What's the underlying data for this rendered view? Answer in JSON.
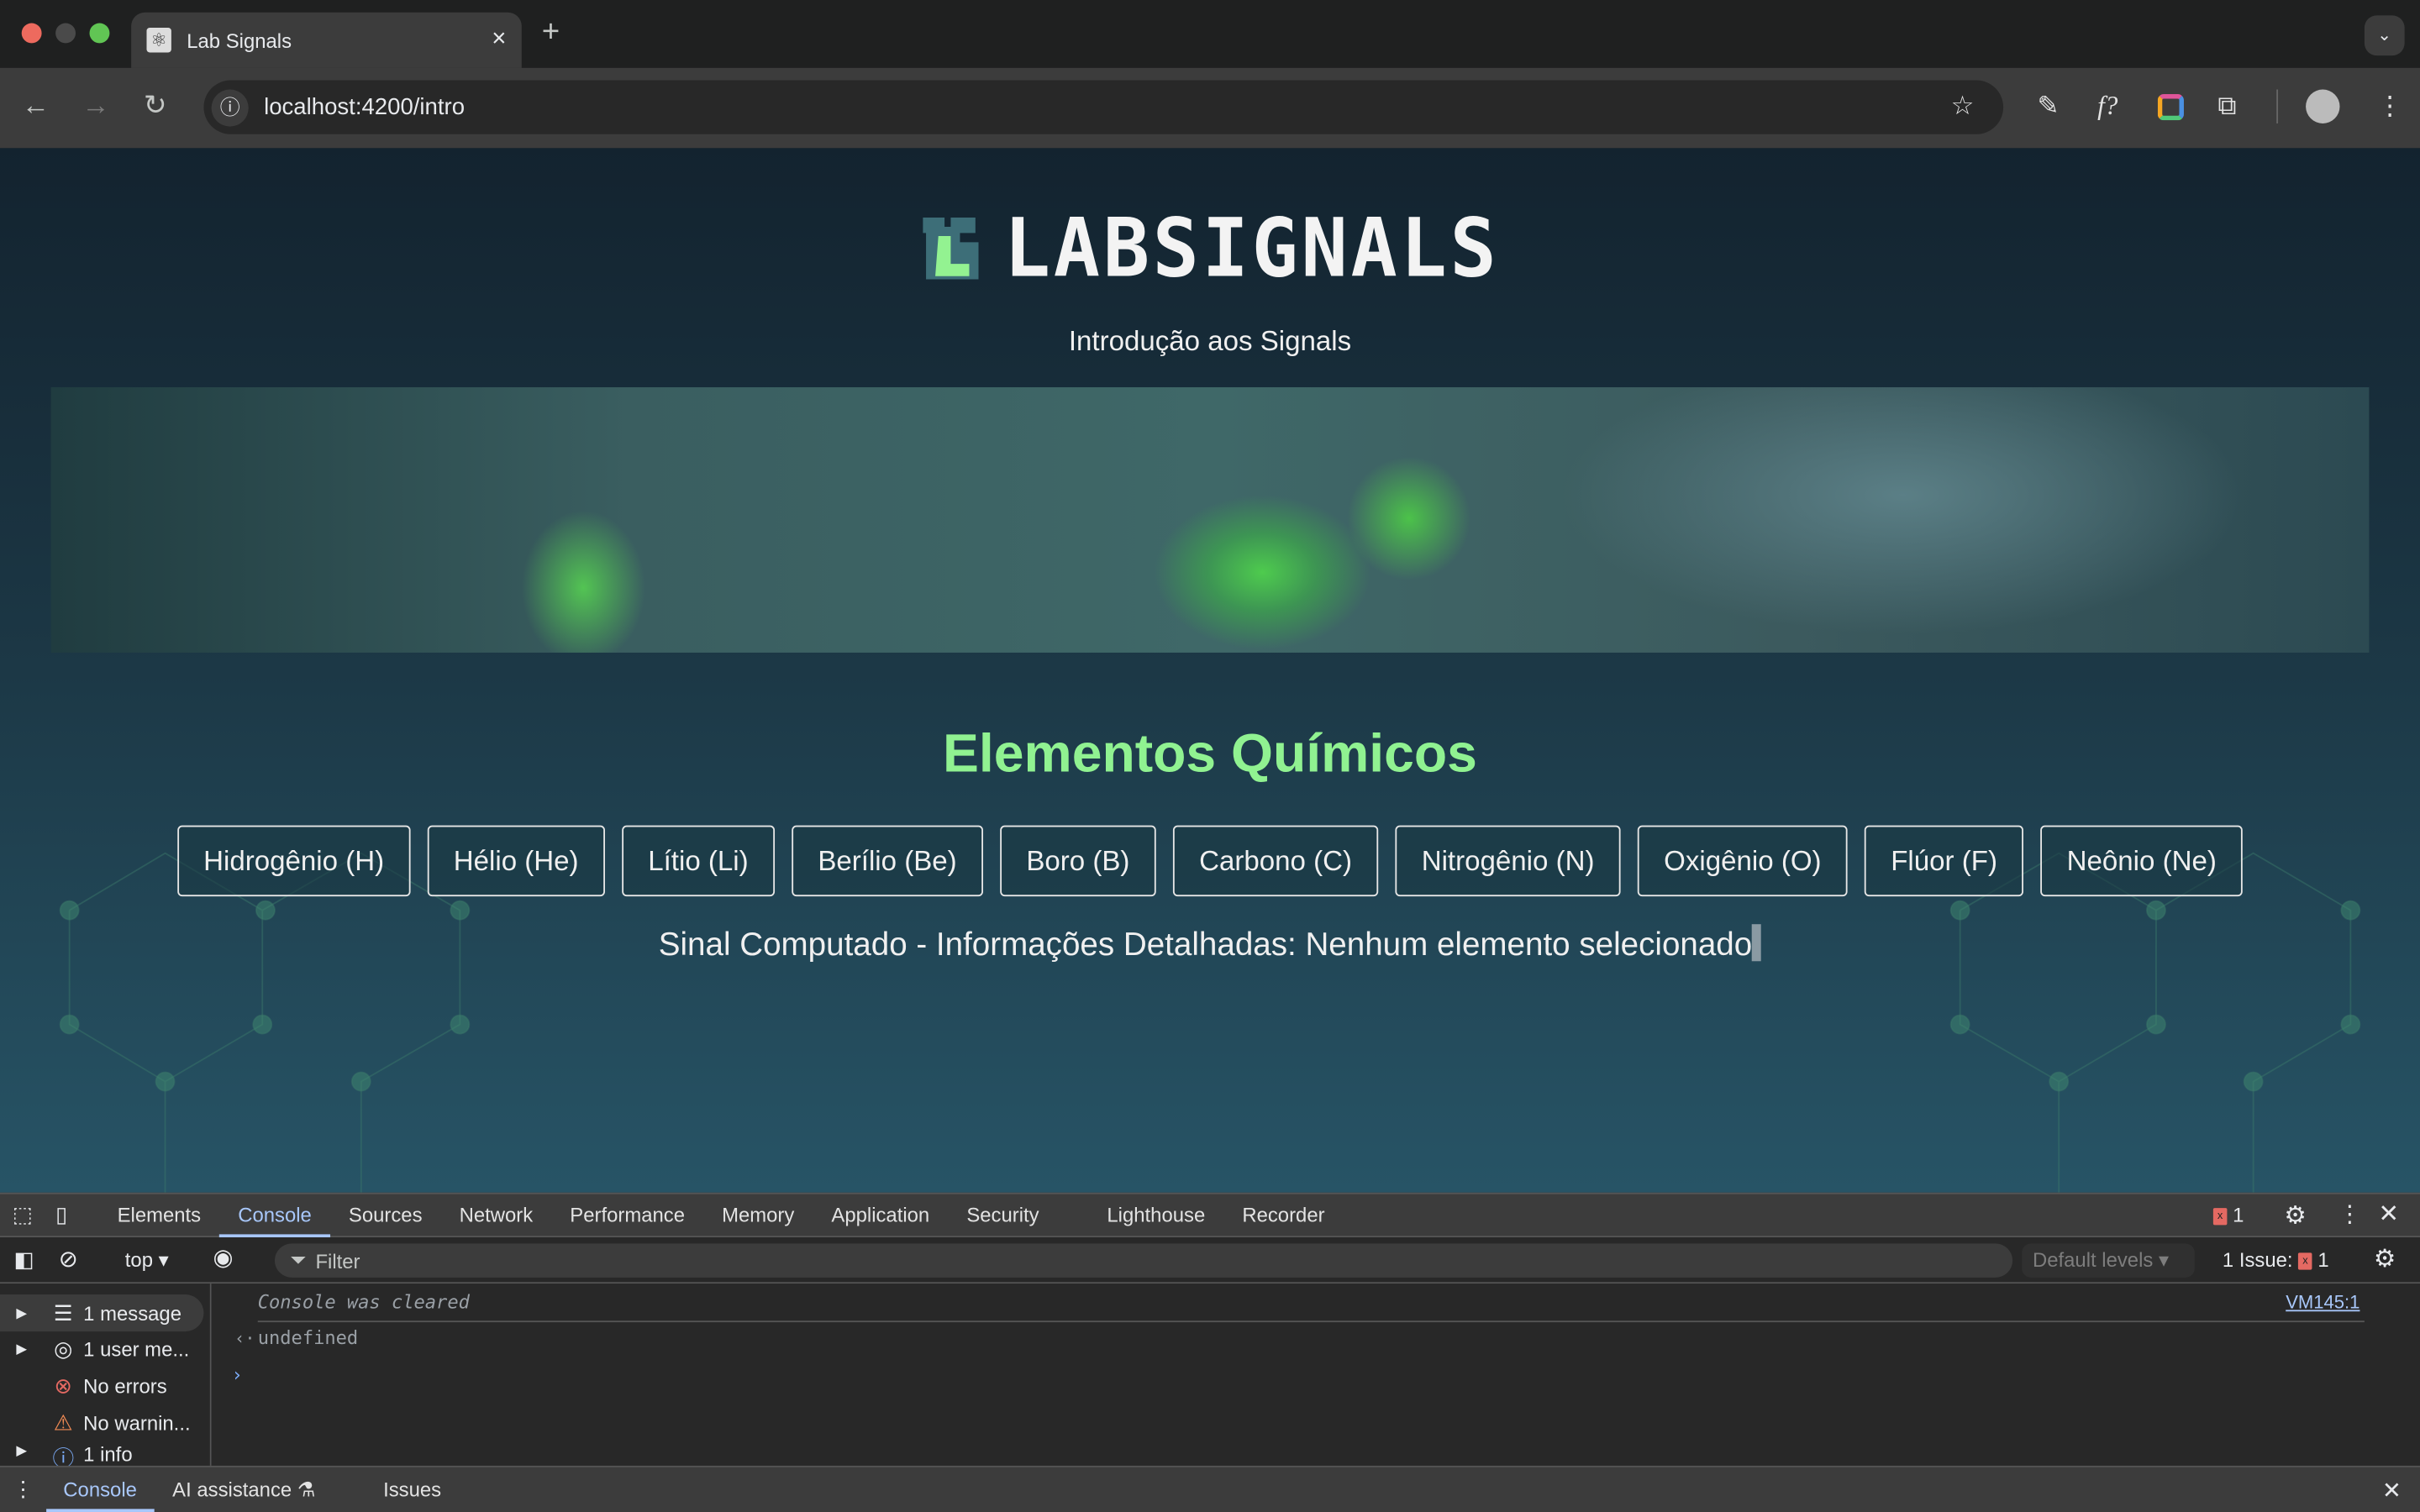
{
  "browser": {
    "tab_title": "Lab Signals",
    "tab_close": "×",
    "new_tab": "+",
    "url": "localhost:4200/intro",
    "nav": {
      "back": "←",
      "forward": "→",
      "reload": "↻"
    },
    "toolbar_icons": [
      "star-icon",
      "eyedropper-icon",
      "function-icon",
      "color-wheel-icon",
      "extensions-icon",
      "profile-avatar",
      "menu-icon"
    ]
  },
  "page": {
    "logo_text": "LABSIGNALS",
    "subtitle": "Introdução aos Signals",
    "heading": "Elementos Químicos",
    "elements": [
      {
        "label": "Hidrogênio (H)"
      },
      {
        "label": "Hélio (He)"
      },
      {
        "label": "Lítio (Li)"
      },
      {
        "label": "Berílio (Be)"
      },
      {
        "label": "Boro (B)"
      },
      {
        "label": "Carbono (C)"
      },
      {
        "label": "Nitrogênio (N)"
      },
      {
        "label": "Oxigênio (O)"
      },
      {
        "label": "Flúor (F)"
      },
      {
        "label": "Neônio (Ne)"
      }
    ],
    "signal_text": "Sinal Computado - Informações Detalhadas: Nenhum elemento selecionado",
    "colors": {
      "accent": "#90f291",
      "background_top": "#13232f",
      "background_bottom": "#275466"
    }
  },
  "devtools": {
    "tabs": [
      "Elements",
      "Console",
      "Sources",
      "Network",
      "Performance",
      "Memory",
      "Application",
      "Security",
      "Lighthouse",
      "Recorder"
    ],
    "active_tab": "Console",
    "error_count": "1",
    "context": "top ▾",
    "filter_placeholder": "Filter",
    "levels": "Default levels ▾",
    "issues_label": "1 Issue:",
    "issues_count": "1",
    "sidebar": [
      {
        "label": "1 message"
      },
      {
        "label": "1 user me..."
      },
      {
        "label": "No errors"
      },
      {
        "label": "No warnin..."
      },
      {
        "label": "1 info"
      }
    ],
    "messages": {
      "cleared": "Console was cleared",
      "source": "VM145:1",
      "result": "undefined",
      "prompt": "›",
      "result_arrow": "‹·"
    },
    "drawer_tabs": [
      "Console",
      "AI assistance",
      "Issues"
    ]
  }
}
